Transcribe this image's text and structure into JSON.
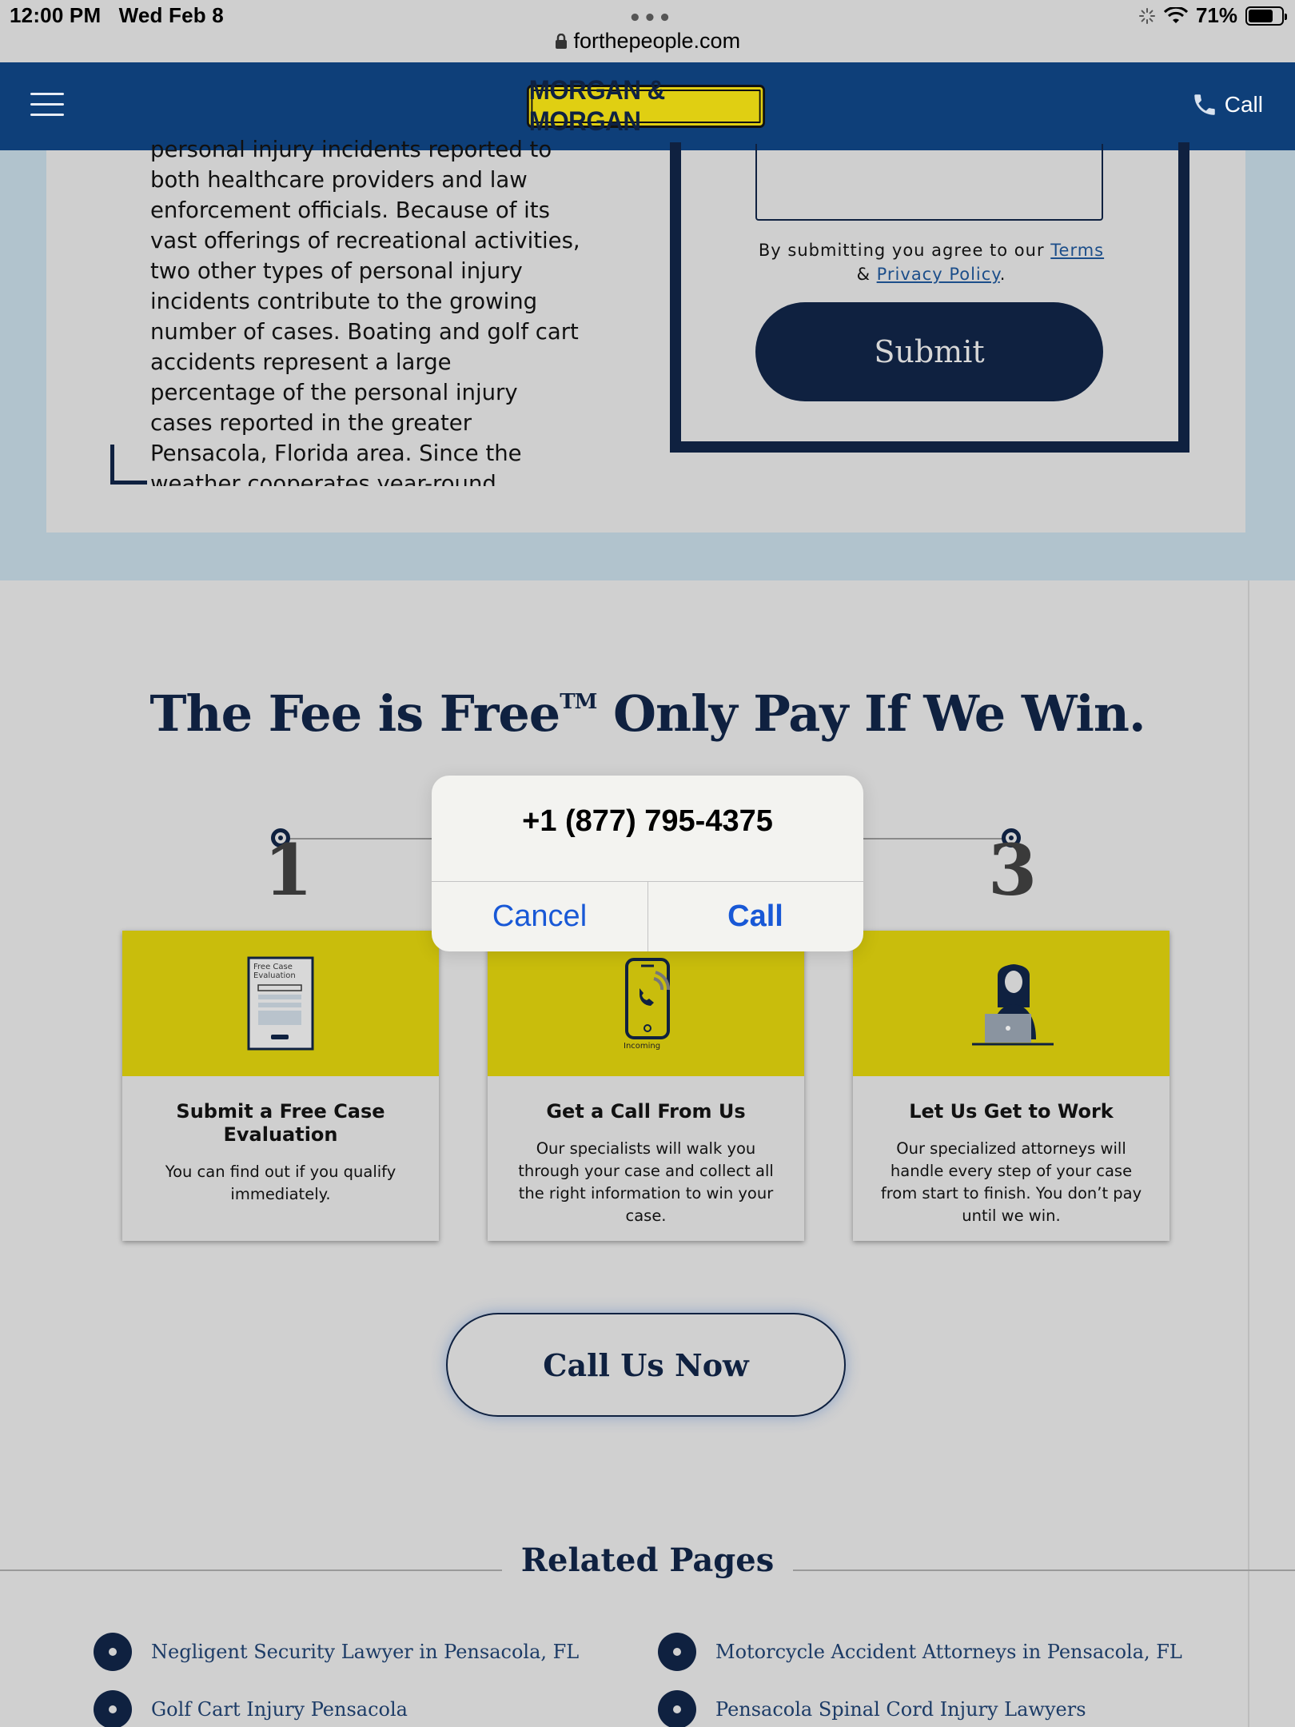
{
  "status_bar": {
    "time": "12:00 PM",
    "date": "Wed Feb 8",
    "battery": "71%",
    "dots": "•••"
  },
  "browser": {
    "url": "forthepeople.com"
  },
  "nav": {
    "logo_text": "MORGAN & MORGAN",
    "call_label": "Call"
  },
  "article": {
    "text": "personal injury incidents reported to both healthcare providers and law enforcement officials. Because of its vast offerings of recreational activities, two other types of personal injury incidents contribute to the growing number of cases. Boating and golf cart accidents represent a large percentage of the personal injury cases reported in the greater Pensacola, Florida area. Since the weather cooperates year-round, Pensacola experiences many more"
  },
  "form": {
    "terms_prefix": "By submitting you agree to our ",
    "terms_link": "Terms",
    "terms_amp": " & ",
    "privacy_link": "Privacy Policy",
    "terms_suffix": ".",
    "submit_label": "Submit"
  },
  "fee": {
    "heading_a": "The Fee is Free",
    "heading_tm": "TM",
    "heading_b": " Only Pay If We Win.",
    "step1_num": "1",
    "step3_num": "3"
  },
  "cards": [
    {
      "title": "Submit a Free Case Evaluation",
      "desc": "You can find out if you qualify immediately.",
      "icon": "form-icon",
      "icon_text": "Free Case Evaluation"
    },
    {
      "title": "Get a Call From Us",
      "desc": "Our specialists will walk you through your case and collect all the right information to win your case.",
      "icon": "phone-icon",
      "icon_text": "Incoming"
    },
    {
      "title": "Let Us Get to Work",
      "desc": "Our specialized attorneys will handle every step of your case from start to finish. You don’t pay until we win.",
      "icon": "attorney-laptop-icon"
    }
  ],
  "call_now_label": "Call Us Now",
  "related": {
    "heading": "Related Pages",
    "items": [
      "Negligent Security Lawyer in Pensacola, FL",
      "Motorcycle Accident Attorneys in Pensacola, FL",
      "Golf Cart Injury Pensacola",
      "Pensacola Spinal Cord Injury Lawyers"
    ]
  },
  "dialog": {
    "number": "+1 (877) 795-4375",
    "cancel_label": "Cancel",
    "call_label": "Call"
  },
  "colors": {
    "navy": "#0f2140",
    "nav_blue": "#0e3f79",
    "yellow": "#c9bd0c",
    "ios_blue": "#1858d6"
  }
}
